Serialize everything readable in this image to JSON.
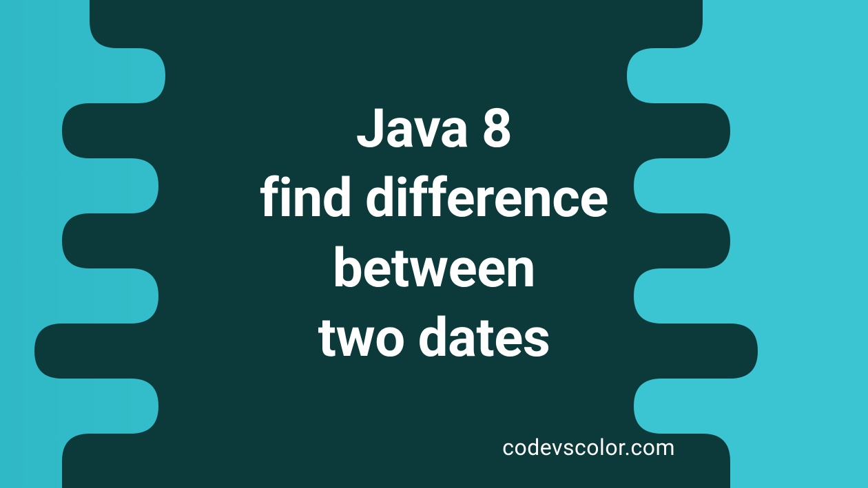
{
  "banner": {
    "title_line1": "Java 8",
    "title_line2": "find difference",
    "title_line3": "between",
    "title_line4": "two dates",
    "attribution": "codevscolor.com"
  },
  "colors": {
    "background_teal": "#3bc4d1",
    "blob_dark": "#0c3a3a",
    "text": "#ffffff"
  }
}
